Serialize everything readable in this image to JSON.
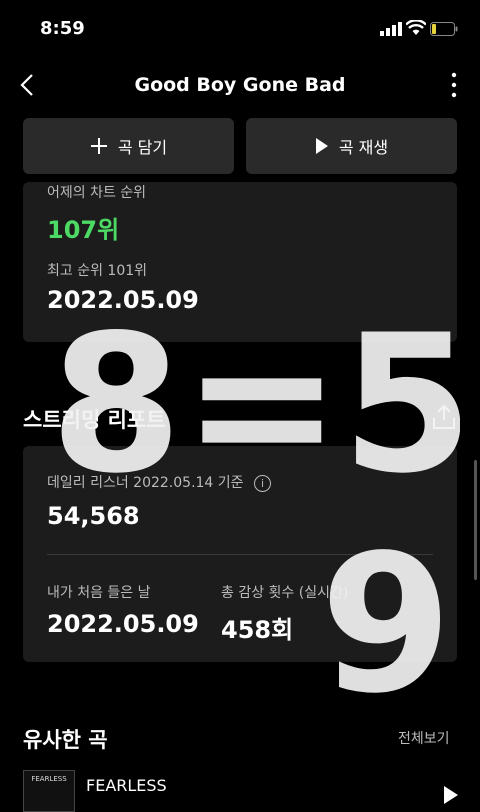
{
  "status": {
    "time": "8:59"
  },
  "nav": {
    "title": "Good Boy Gone Bad"
  },
  "actions": {
    "add_label": "곡 담기",
    "play_label": "곡 재생"
  },
  "chart": {
    "yesterday_label": "어제의 차트 순위",
    "yesterday_rank": "107위",
    "best_label": "최고 순위 101위",
    "best_date": "2022.05.09"
  },
  "streaming": {
    "title": "스트리밍 리포트",
    "daily_label": "데일리 리스너 2022.05.14 기준",
    "daily_value": "54,568",
    "first_listen_label": "내가 처음 들은 날",
    "first_listen_value": "2022.05.09",
    "play_count_label": "총 감상 횟수 (실시간)",
    "play_count_value": "458회"
  },
  "similar": {
    "title": "유사한 곡",
    "see_all": "전체보기",
    "songs": [
      {
        "title": "FEARLESS",
        "album_text": "FEARLESS"
      }
    ]
  },
  "overlay": {
    "handwriting": "8=5 9"
  },
  "colors": {
    "background": "#000000",
    "card": "#1c1c1c",
    "button": "#2a2a2a",
    "rank_green": "#4cd964"
  }
}
